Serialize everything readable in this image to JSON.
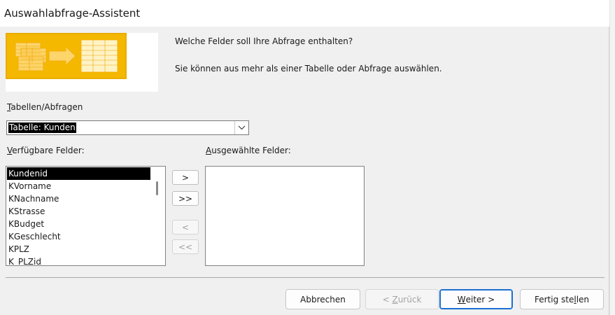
{
  "window": {
    "title": "Auswahlabfrage-Assistent"
  },
  "intro": {
    "question": "Welche Felder soll Ihre Abfrage enthalten?",
    "hint": "Sie können aus mehr als einer Tabelle oder Abfrage auswählen."
  },
  "tables": {
    "label_first": "T",
    "label_rest": "abellen/Abfragen",
    "selected": "Tabelle: Kunden"
  },
  "available": {
    "label_first": "V",
    "label_rest": "erfügbare Felder:",
    "items": [
      "Kundenid",
      "KVorname",
      "KNachname",
      "KStrasse",
      "KBudget",
      "KGeschlecht",
      "KPLZ",
      "K_PLZid"
    ],
    "selected_index": 0
  },
  "chosen": {
    "label_first": "A",
    "label_rest": "usgewählte Felder:",
    "items": []
  },
  "move_buttons": {
    "add_one": ">",
    "add_all": ">>",
    "remove_one": "<",
    "remove_all": "<<"
  },
  "buttons": {
    "cancel": "Abbrechen",
    "back_pre": "< ",
    "back_first": "Z",
    "back_rest": "urück",
    "next_first": "W",
    "next_rest": "eiter >",
    "finish_pre": "Fertig ste",
    "finish_u": "l",
    "finish_rest": "len"
  },
  "colors": {
    "selection": "#000000",
    "default_button_border": "#1a6fd1",
    "wizard_image_yellow": "#f5b800"
  },
  "icons": {
    "dropdown": "chevron-down-icon",
    "wizard_graphic": "table-transfer-icon"
  }
}
